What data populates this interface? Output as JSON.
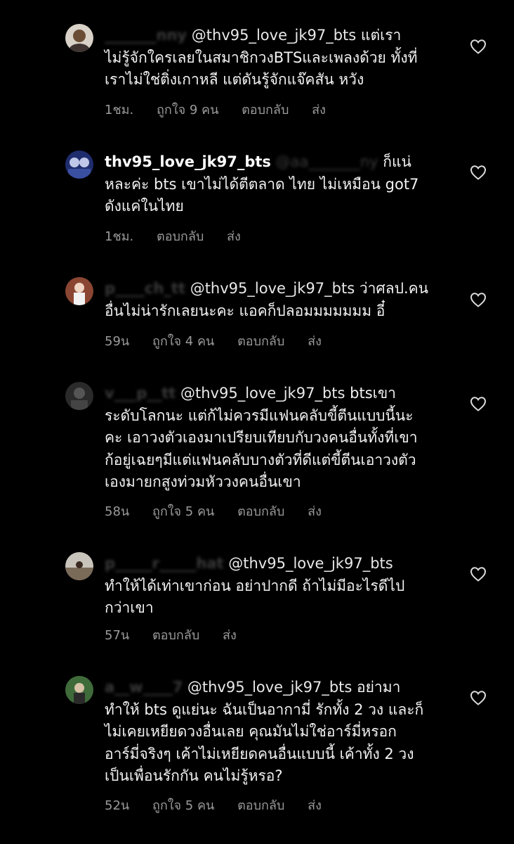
{
  "comments": [
    {
      "username": "_______nny",
      "mention": "@thv95_love_jk97_bts",
      "lines": [
        "แต่เรา",
        "ไม่รู้จักใครเลยในสมาชิกวงBTSและเพลงด้วย ทั้งที่",
        "เราไม่ใช่ติ่งเกาหลี แต่ดันรู้จักแจ๊คสัน หวัง"
      ],
      "time": "1ชม.",
      "likes": "ถูกใจ 9 คน",
      "reply": "ตอบกลับ",
      "send": "ส่ง"
    },
    {
      "username": "thv95_love_jk97_bts",
      "mention": "@aa_______ny",
      "lines": [
        "ก็แน่",
        "หละค่ะ bts เขาไม่ได้ตีตลาด ไทย ไม่เหมือน got7",
        "ดังแค่ในไทย"
      ],
      "time": "1ชม.",
      "likes": "",
      "reply": "ตอบกลับ",
      "send": "ส่ง"
    },
    {
      "username": "p____ch_tt",
      "mention": "@thv95_love_jk97_bts",
      "lines": [
        "ว่าศลป.คน",
        "อื่นไม่น่ารักเลยนะคะ แอคก็ปลอมมมมมมม อี๋"
      ],
      "time": "59น",
      "likes": "ถูกใจ 4 คน",
      "reply": "ตอบกลับ",
      "send": "ส่ง"
    },
    {
      "username": "v___p__tt",
      "mention": "@thv95_love_jk97_bts",
      "lines": [
        "btsเขา",
        "ระดับโลกนะ แต่ก้ไม่ควรมีแฟนคลับขี้ตีนแบบนี้นะ",
        "คะ เอาวงตัวเองมาเปรียบเทียบกับวงคนอื่นทั้งที่เขา",
        "ก้อยู่เฉยๆมีแต่แฟนคลับบางตัวที่ดีแต่ขี้ตีนเอาวงตัว",
        "เองมายกสูงท่วมหัววงคนอื่นเขา"
      ],
      "time": "58น",
      "likes": "ถูกใจ 5 คน",
      "reply": "ตอบกลับ",
      "send": "ส่ง"
    },
    {
      "username": "p_____r_____hat",
      "mention": "@thv95_love_jk97_bts",
      "lines": [
        "",
        "ทำให้ได้เท่าเขาก่อน อย่าปากดี ถ้าไม่มีอะไรดีไป",
        "กว่าเขา"
      ],
      "time": "57น",
      "likes": "",
      "reply": "ตอบกลับ",
      "send": "ส่ง"
    },
    {
      "username": "a__w____7",
      "mention": "@thv95_love_jk97_bts",
      "lines": [
        "อย่ามา",
        "ทำให้ bts ดูแย่นะ ฉันเป็นอากามี่ รักทั้ง 2 วง และก็",
        "ไม่เคยเหยียดวงอื่นเลย คุณมันไม่ใช่อาร์มี่หรอก",
        "อาร์มี่จริงๆ เค้าไม่เหยียดคนอื่นแบบนี้ เค้าทั้ง 2 วง",
        "เป็นเพื่อนรักกัน คนไม่รู้หรอ?"
      ],
      "time": "52น",
      "likes": "ถูกใจ 5 คน",
      "reply": "ตอบกลับ",
      "send": "ส่ง"
    }
  ]
}
